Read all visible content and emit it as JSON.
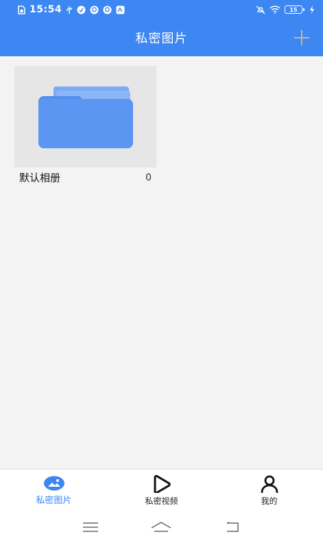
{
  "status_bar": {
    "time": "15:54",
    "battery": "15"
  },
  "header": {
    "title": "私密图片",
    "add_icon": "plus-icon"
  },
  "albums": [
    {
      "name": "默认相册",
      "count": "0",
      "icon": "folder-icon"
    }
  ],
  "bottom_nav": {
    "items": [
      {
        "label": "私密图片",
        "icon": "image-icon",
        "active": true
      },
      {
        "label": "私密视频",
        "icon": "play-icon",
        "active": false
      },
      {
        "label": "我的",
        "icon": "user-icon",
        "active": false
      }
    ]
  },
  "colors": {
    "accent": "#3d87f3",
    "background": "#f3f3f3",
    "thumb_bg": "#e6e6e6"
  }
}
